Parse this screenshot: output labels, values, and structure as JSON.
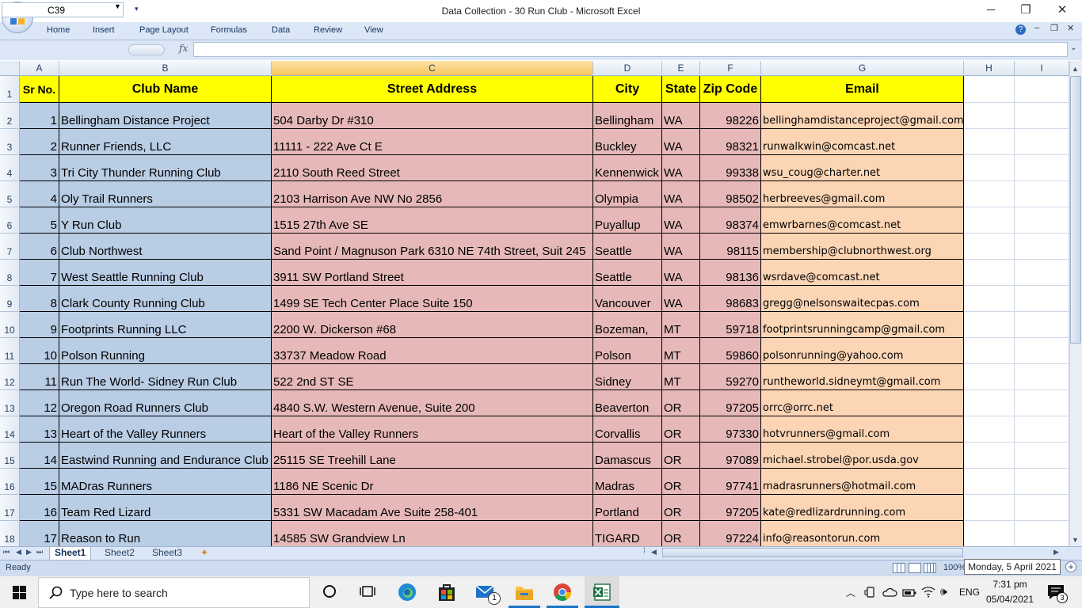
{
  "window": {
    "title": "Data Collection - 30 Run Club - Microsoft Excel",
    "minimize": "─",
    "restore": "❐",
    "close": "✕"
  },
  "ribbon": {
    "tabs": [
      "Home",
      "Insert",
      "Page Layout",
      "Formulas",
      "Data",
      "Review",
      "View"
    ]
  },
  "formula_bar": {
    "name_box": "C39",
    "fx_label": "fx",
    "formula": ""
  },
  "columns": [
    "A",
    "B",
    "C",
    "D",
    "E",
    "F",
    "G",
    "H",
    "I"
  ],
  "selected_column": "C",
  "headers": [
    "Sr No.",
    "Club Name",
    "Street Address",
    "City",
    "State",
    "Zip Code",
    "Email"
  ],
  "rows": [
    {
      "row": "2",
      "sr": "1",
      "club": "Bellingham Distance Project",
      "address": "504 Darby Dr #310",
      "city": "Bellingham",
      "state": "WA",
      "zip": "98226",
      "email": "bellinghamdistanceproject@gmail.com"
    },
    {
      "row": "3",
      "sr": "2",
      "club": "Runner Friends, LLC",
      "address": "11111 - 222 Ave Ct E",
      "city": "Buckley",
      "state": "WA",
      "zip": "98321",
      "email": "runwalkwin@comcast.net"
    },
    {
      "row": "4",
      "sr": "3",
      "club": "Tri City Thunder Running Club",
      "address": "2110 South Reed Street",
      "city": "Kennenwick",
      "state": "WA",
      "zip": "99338",
      "email": "wsu_coug@charter.net"
    },
    {
      "row": "5",
      "sr": "4",
      "club": "Oly Trail Runners",
      "address": "2103 Harrison Ave NW No 2856",
      "city": "Olympia",
      "state": "WA",
      "zip": "98502",
      "email": "herbreeves@gmail.com"
    },
    {
      "row": "6",
      "sr": "5",
      "club": "Y Run Club",
      "address": "1515 27th Ave SE",
      "city": "Puyallup",
      "state": "WA",
      "zip": "98374",
      "email": "emwrbarnes@comcast.net"
    },
    {
      "row": "7",
      "sr": "6",
      "club": "Club Northwest",
      "address": "Sand Point / Magnuson Park 6310 NE 74th Street, Suit 245",
      "city": "Seattle",
      "state": "WA",
      "zip": "98115",
      "email": "membership@clubnorthwest.org"
    },
    {
      "row": "8",
      "sr": "7",
      "club": "West Seattle Running Club",
      "address": "3911 SW Portland Street",
      "city": "Seattle",
      "state": "WA",
      "zip": "98136",
      "email": "wsrdave@comcast.net"
    },
    {
      "row": "9",
      "sr": "8",
      "club": "Clark County Running Club",
      "address": "1499 SE Tech Center Place Suite 150",
      "city": "Vancouver",
      "state": "WA",
      "zip": "98683",
      "email": "gregg@nelsonswaitecpas.com"
    },
    {
      "row": "10",
      "sr": "9",
      "club": "Footprints Running LLC",
      "address": "2200 W. Dickerson #68",
      "city": "Bozeman,",
      "state": "MT",
      "zip": "59718",
      "email": "footprintsrunningcamp@gmail.com"
    },
    {
      "row": "11",
      "sr": "10",
      "club": "Polson Running",
      "address": "33737 Meadow Road",
      "city": "Polson",
      "state": "MT",
      "zip": "59860",
      "email": "polsonrunning@yahoo.com"
    },
    {
      "row": "12",
      "sr": "11",
      "club": "Run The World- Sidney Run Club",
      "address": "522 2nd ST SE",
      "city": "Sidney",
      "state": "MT",
      "zip": "59270",
      "email": "runtheworld.sidneymt@gmail.com"
    },
    {
      "row": "13",
      "sr": "12",
      "club": "Oregon Road Runners Club",
      "address": "4840 S.W. Western Avenue, Suite 200",
      "city": "Beaverton",
      "state": "OR",
      "zip": "97205",
      "email": "orrc@orrc.net"
    },
    {
      "row": "14",
      "sr": "13",
      "club": "Heart of the Valley Runners",
      "address": "Heart of the Valley Runners",
      "city": "Corvallis",
      "state": "OR",
      "zip": "97330",
      "email": "hotvrunners@gmail.com"
    },
    {
      "row": "15",
      "sr": "14",
      "club": "Eastwind Running and Endurance Club",
      "address": "25115 SE Treehill Lane",
      "city": "Damascus",
      "state": "OR",
      "zip": "97089",
      "email": "michael.strobel@por.usda.gov"
    },
    {
      "row": "16",
      "sr": "15",
      "club": "MADras Runners",
      "address": "1186 NE Scenic Dr",
      "city": "Madras",
      "state": "OR",
      "zip": "97741",
      "email": "madrasrunners@hotmail.com"
    },
    {
      "row": "17",
      "sr": "16",
      "club": "Team Red Lizard",
      "address": "5331 SW Macadam Ave Suite 258-401",
      "city": "Portland",
      "state": "OR",
      "zip": "97205",
      "email": "kate@redlizardrunning.com"
    },
    {
      "row": "18",
      "sr": "17",
      "club": "Reason to Run",
      "address": "14585 SW Grandview Ln",
      "city": "TIGARD",
      "state": "OR",
      "zip": "97224",
      "email": "info@reasontorun.com"
    }
  ],
  "sheet_tabs": [
    "Sheet1",
    "Sheet2",
    "Sheet3"
  ],
  "active_sheet": "Sheet1",
  "status": {
    "ready": "Ready",
    "zoom": "100%",
    "tooltip": "Monday, 5 April 2021"
  },
  "taskbar": {
    "search_placeholder": "Type here to search",
    "lang": "ENG",
    "time": "7:31 pm",
    "date": "05/04/2021",
    "notification_count": "3",
    "mail_badge": "1"
  }
}
